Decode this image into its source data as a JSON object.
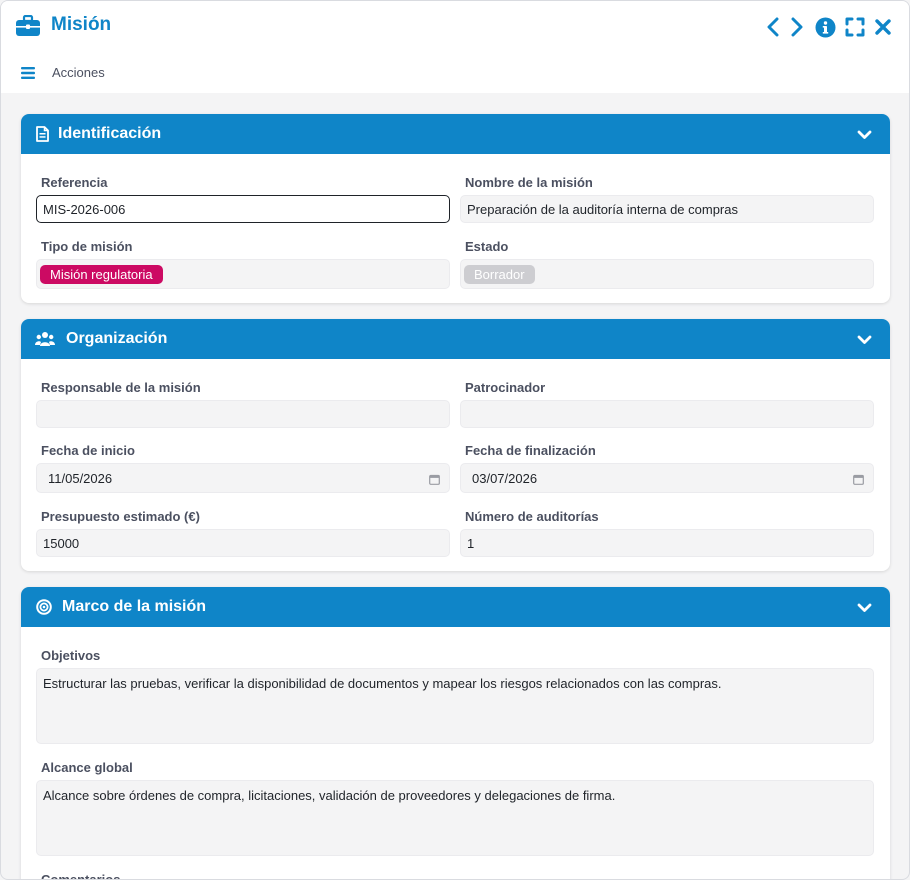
{
  "window": {
    "title": "Misión",
    "title_icon": "briefcase-icon"
  },
  "toolbar": {
    "actions_label": "Acciones"
  },
  "colors": {
    "accent": "#0f85c8",
    "tag_type": "#cc0a63",
    "tag_state": "#cdcdd1"
  },
  "sections": {
    "identificacion": {
      "title": "Identificación",
      "referencia_label": "Referencia",
      "referencia_value": "MIS-2026-006",
      "nombre_label": "Nombre de la misión",
      "nombre_value": "Preparación de la auditoría interna de compras",
      "tipo_label": "Tipo de misión",
      "tipo_value": "Misión regulatoria",
      "estado_label": "Estado",
      "estado_value": "Borrador"
    },
    "organizacion": {
      "title": "Organización",
      "responsable_label": "Responsable de la misión",
      "responsable_value": "",
      "patrocinador_label": "Patrocinador",
      "patrocinador_value": "",
      "fecha_inicio_label": "Fecha de inicio",
      "fecha_inicio_value": "11/05/2026",
      "fecha_fin_label": "Fecha de finalización",
      "fecha_fin_value": "03/07/2026",
      "presupuesto_label": "Presupuesto estimado (€)",
      "presupuesto_value": "15000",
      "num_auditorias_label": "Número de auditorías",
      "num_auditorias_value": "1"
    },
    "marco": {
      "title": "Marco de la misión",
      "objetivos_label": "Objetivos",
      "objetivos_value": "Estructurar las pruebas, verificar la disponibilidad de documentos y mapear los riesgos relacionados con las compras.",
      "alcance_label": "Alcance global",
      "alcance_value": "Alcance sobre órdenes de compra, licitaciones, validación de proveedores y delegaciones de firma.",
      "comentarios_label": "Comentarios"
    }
  }
}
